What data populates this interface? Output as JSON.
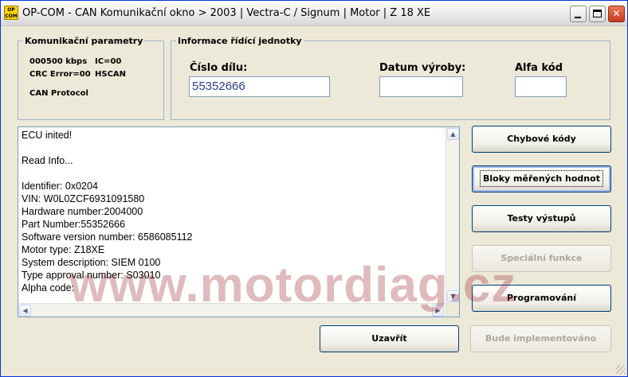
{
  "window": {
    "title": "OP-COM - CAN Komunikační okno > 2003 | Vectra-C / Signum | Motor | Z 18 XE",
    "icon_top": "OP",
    "icon_bottom": "COM",
    "minimize_icon": "minimize-icon",
    "maximize_icon": "maximize-icon",
    "close_icon": "close-icon",
    "close_glyph": "✕"
  },
  "comm_params": {
    "legend": "Komunikační parametry",
    "speed": "000500 kbps",
    "ic": "IC=00",
    "crc": "CRC Error=00",
    "bus": "HSCAN",
    "protocol": "CAN Protocol"
  },
  "ecu_info": {
    "legend": "Informace řídící jednotky",
    "part_label": "Číslo dílu:",
    "part_value": "55352666",
    "date_label": "Datum výroby:",
    "date_value": "",
    "alpha_label": "Alfa kód",
    "alpha_value": ""
  },
  "log": {
    "lines": [
      "ECU inited!",
      "",
      "Read Info...",
      "",
      "Identifier: 0x0204",
      "VIN: W0L0ZCF6931091580",
      "Hardware number:2004000",
      "Part Number:55352666",
      "Software version number: 6586085112",
      "Motor type: Z18XE",
      "System description: SIEM 0100",
      "Type approval number: S03010",
      "Alpha code:"
    ],
    "arrow_up": "▲",
    "arrow_down": "▼",
    "arrow_left": "◀",
    "arrow_right": "▶"
  },
  "buttons": {
    "error_codes": "Chybové kódy",
    "measured_blocks": "Bloky měřených hodnot",
    "output_tests": "Testy výstupů",
    "special_functions": "Speciální funkce",
    "programming": "Programování",
    "close": "Uzavřít",
    "to_be_implemented": "Bude implementováno"
  },
  "watermark": "www.motordiag.cz"
}
